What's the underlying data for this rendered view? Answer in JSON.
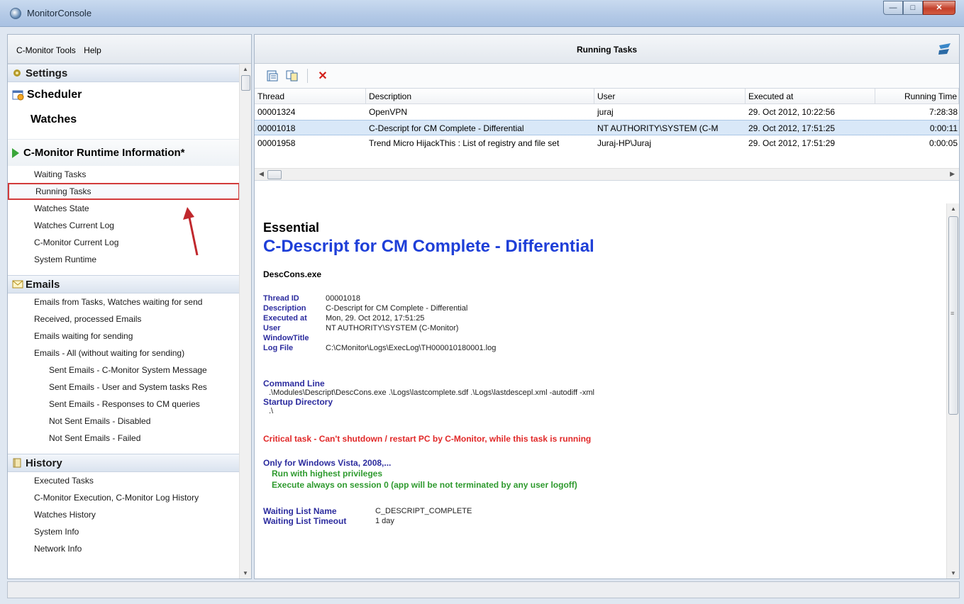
{
  "window": {
    "title": "MonitorConsole"
  },
  "menu": {
    "items": [
      "C-Monitor Tools",
      "Help"
    ]
  },
  "sidebar": {
    "settings": "Settings",
    "scheduler": "Scheduler",
    "watches": "Watches",
    "runtime_header": "C-Monitor Runtime Information*",
    "runtime_items": [
      "Waiting Tasks",
      "Running Tasks",
      "Watches State",
      "Watches Current Log",
      "C-Monitor Current Log",
      "System Runtime"
    ],
    "emails_header": "Emails",
    "emails_items": [
      "Emails from Tasks, Watches waiting for send",
      "Received, processed Emails",
      "Emails waiting for sending",
      "Emails - All (without waiting for sending)"
    ],
    "emails_sub_items": [
      "Sent Emails - C-Monitor System Message",
      "Sent Emails - User and System tasks Res",
      "Sent Emails - Responses to CM queries",
      "Not Sent Emails - Disabled",
      "Not Sent Emails - Failed"
    ],
    "history_header": "History",
    "history_items": [
      "Executed Tasks",
      "C-Monitor Execution, C-Monitor Log History",
      "Watches History",
      "System Info",
      "Network Info"
    ]
  },
  "panel": {
    "title": "Running Tasks"
  },
  "grid": {
    "headers": [
      "Thread",
      "Description",
      "User",
      "Executed at",
      "Running Time"
    ],
    "rows": [
      [
        "00001324",
        "OpenVPN",
        "juraj",
        "29. Oct 2012, 10:22:56",
        "7:28:38"
      ],
      [
        "00001018",
        "C-Descript for CM Complete - Differential",
        "NT AUTHORITY\\SYSTEM (C-M",
        "29. Oct 2012, 17:51:25",
        "0:00:11"
      ],
      [
        "00001958",
        "Trend Micro HijackThis : List of registry and file set",
        "Juraj-HP\\Juraj",
        "29. Oct 2012, 17:51:29",
        "0:00:05"
      ]
    ],
    "selected_row": 1
  },
  "detail": {
    "section": "Essential",
    "title": "C-Descript for CM Complete - Differential",
    "exe": "DescCons.exe",
    "fields": [
      {
        "k": "Thread ID",
        "v": "00001018"
      },
      {
        "k": "Description",
        "v": "C-Descript for CM Complete - Differential"
      },
      {
        "k": "Executed at",
        "v": "Mon, 29. Oct 2012, 17:51:25"
      },
      {
        "k": "User",
        "v": "NT AUTHORITY\\SYSTEM (C-Monitor)"
      },
      {
        "k": "WindowTitle",
        "v": ""
      },
      {
        "k": "Log File",
        "v": "C:\\CMonitor\\Logs\\ExecLog\\TH000010180001.log"
      }
    ],
    "command_line_label": "Command Line",
    "command_line": ".\\Modules\\Descript\\DescCons.exe .\\Logs\\lastcomplete.sdf .\\Logs\\lastdescepl.xml -autodiff -xml",
    "startup_dir_label": "Startup Directory",
    "startup_dir": ".\\",
    "critical": "Critical task - Can't shutdown / restart PC by C-Monitor, while this task is running",
    "vista_label": "Only for Windows Vista, 2008,...",
    "vista_items": [
      "Run with highest privileges",
      "Execute always on session 0 (app will be not terminated by any user logoff)"
    ],
    "waiting_list_name_label": "Waiting List Name",
    "waiting_list_name": "C_DESCRIPT_COMPLETE",
    "waiting_list_timeout_label": "Waiting List Timeout",
    "waiting_list_timeout": "1 day"
  },
  "colors": {
    "accent_blue": "#1e3fd8",
    "critical_red": "#e12828",
    "green": "#2e9a2e",
    "label_blue": "#2c2c9e"
  }
}
